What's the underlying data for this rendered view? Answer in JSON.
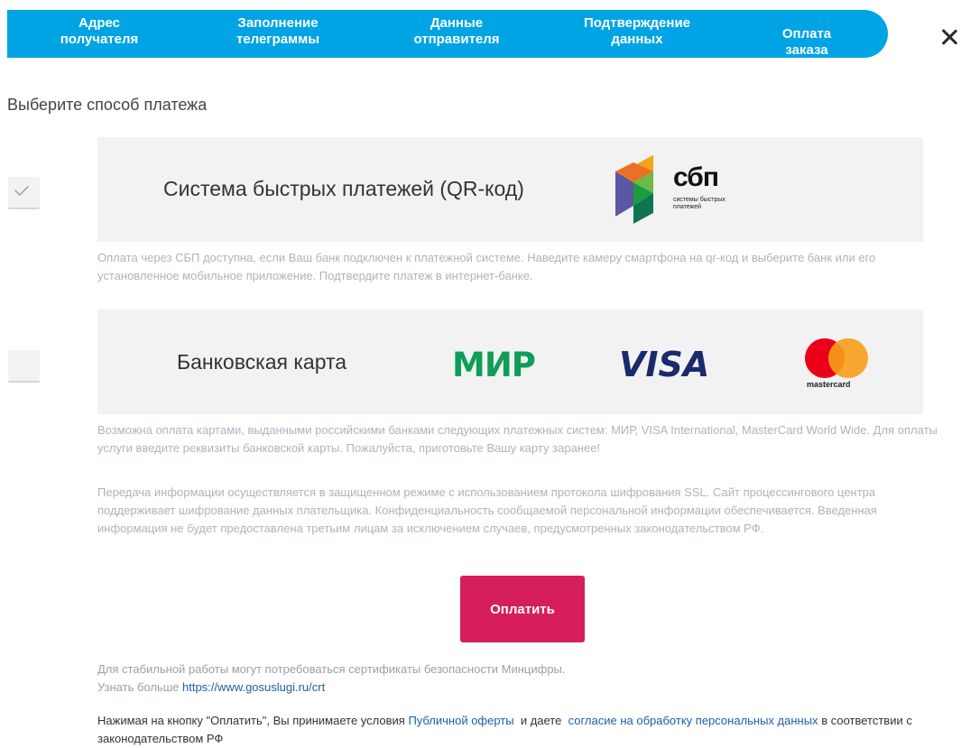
{
  "steps": [
    {
      "label": "Адрес\nполучателя"
    },
    {
      "label": "Заполнение\nтелеграммы"
    },
    {
      "label": "Данные\nотправителя"
    },
    {
      "label": "Подтверждение\nданных"
    },
    {
      "label": "Оплата заказа"
    }
  ],
  "colors": {
    "stepbar": "#00a4e4",
    "pay_button": "#d51e5a",
    "link": "#1f5ea8",
    "muted_text": "#adb4bd"
  },
  "heading": "Выберите способ платежа",
  "methods": {
    "sbp": {
      "label": "Система быстрых платежей (QR-код)",
      "checked": true,
      "logo_text": "сбп",
      "logo_subtext_1": "системы быстрых",
      "logo_subtext_2": "платежей",
      "note": "Оплата через СБП доступна, если Ваш банк подключен к платежной системе. Наведите камеру смартфона на qr-код и выберите банк или его установленное мобильное приложение. Подтвердите платеж в интернет-банке."
    },
    "card": {
      "label": "Банковская карта",
      "checked": false,
      "logos": {
        "mir": "МИР",
        "visa": "VISA",
        "mastercard": "mastercard"
      },
      "note": "Возможна оплата картами, выданными российскими банками следующих платежных систем: МИР, VISA International, MasterCard World Wide. Для оплаты услуги введите реквизиты банковской карты. Пожалуйста, приготовьте Вашу карту заранее!"
    }
  },
  "security_note": "Передача информации осуществляется в защищенном режиме с использованием протокола шифрования SSL. Сайт процессингового центра поддерживает шифрование данных плательщика. Конфиденциальность сообщаемой персональной информации обеспечивается. Введенная информация не будет предоставлена третьим лицам за исключением случаев, предусмотренных законодательством РФ.",
  "pay_button": "Оплатить",
  "certs": {
    "line1": "Для стабильной работы могут потребоваться сертификаты безопасности Минцифры.",
    "line2_prefix": "Узнать больше ",
    "link": "https://www.gosuslugi.ru/crt"
  },
  "terms": {
    "prefix": "Нажимая на кнопку \"Оплатить\", Вы принимаете условия ",
    "offer_link": "Публичной оферты",
    "middle": "  и даете  ",
    "consent_link": "согласие на обработку персональных данных",
    "suffix": "  в соответствии с законодательством РФ"
  }
}
